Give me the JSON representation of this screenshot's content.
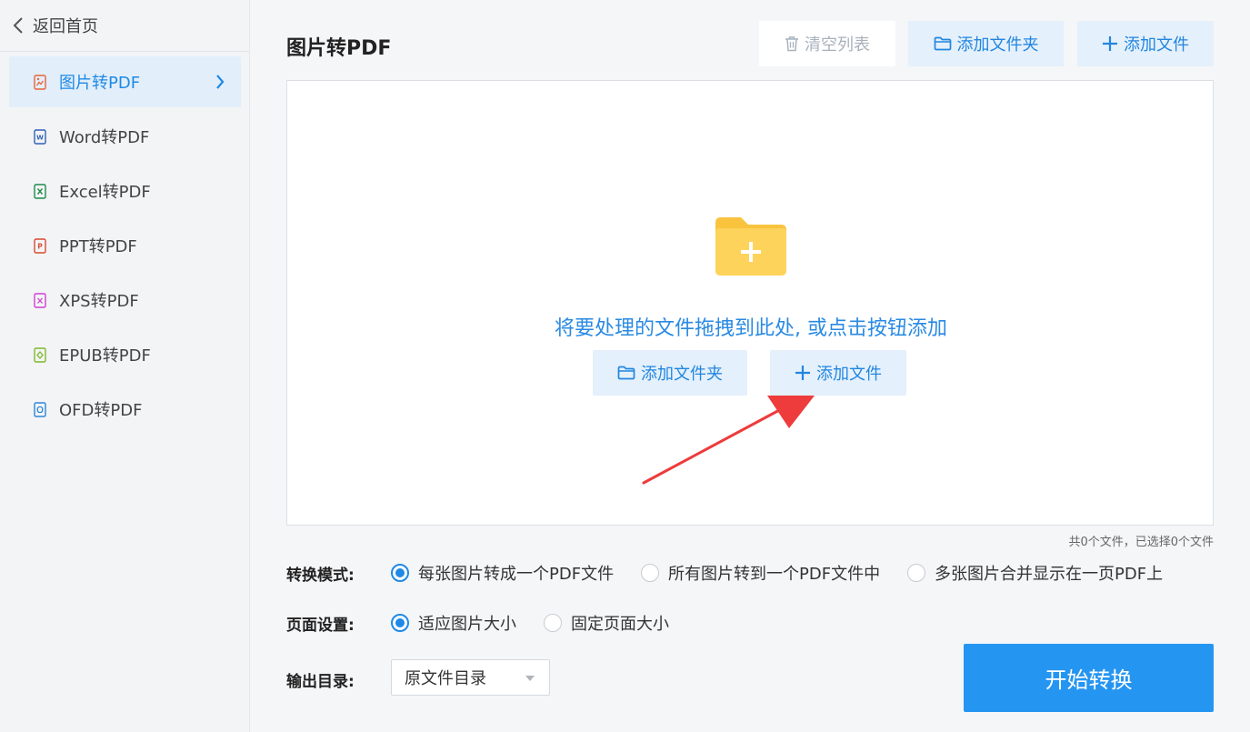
{
  "sidebar": {
    "back_label": "返回首页",
    "items": [
      {
        "label": "图片转PDF",
        "icon": "image-file-icon",
        "color": "#e8633a",
        "active": true
      },
      {
        "label": "Word转PDF",
        "icon": "word-file-icon",
        "color": "#2f5fb5",
        "active": false
      },
      {
        "label": "Excel转PDF",
        "icon": "excel-file-icon",
        "color": "#1f8a4c",
        "active": false
      },
      {
        "label": "PPT转PDF",
        "icon": "ppt-file-icon",
        "color": "#d94a32",
        "active": false
      },
      {
        "label": "XPS转PDF",
        "icon": "xps-file-icon",
        "color": "#d13fcf",
        "active": false
      },
      {
        "label": "EPUB转PDF",
        "icon": "epub-file-icon",
        "color": "#7fb82b",
        "active": false
      },
      {
        "label": "OFD转PDF",
        "icon": "ofd-file-icon",
        "color": "#2b86d8",
        "active": false
      }
    ]
  },
  "main": {
    "title": "图片转PDF",
    "toolbar": {
      "clear_label": "清空列表",
      "add_folder_label": "添加文件夹",
      "add_file_label": "添加文件"
    },
    "dropzone": {
      "hint": "将要处理的文件拖拽到此处, 或点击按钮添加",
      "add_folder_label": "添加文件夹",
      "add_file_label": "添加文件"
    },
    "file_count": "共0个文件，已选择0个文件",
    "convert_mode": {
      "label": "转换模式:",
      "options": [
        {
          "label": "每张图片转成一个PDF文件",
          "selected": true
        },
        {
          "label": "所有图片转到一个PDF文件中",
          "selected": false
        },
        {
          "label": "多张图片合并显示在一页PDF上",
          "selected": false
        }
      ]
    },
    "page_setting": {
      "label": "页面设置:",
      "options": [
        {
          "label": "适应图片大小",
          "selected": true
        },
        {
          "label": "固定页面大小",
          "selected": false
        }
      ]
    },
    "output": {
      "label": "输出目录:",
      "value": "原文件目录"
    },
    "start_label": "开始转换"
  },
  "colors": {
    "accent": "#1e8ae6",
    "button_bg": "#e4f0fb",
    "start_bg": "#2595f2",
    "folder_yellow": "#fdd35c",
    "arrow_red": "#ee3b3b"
  }
}
